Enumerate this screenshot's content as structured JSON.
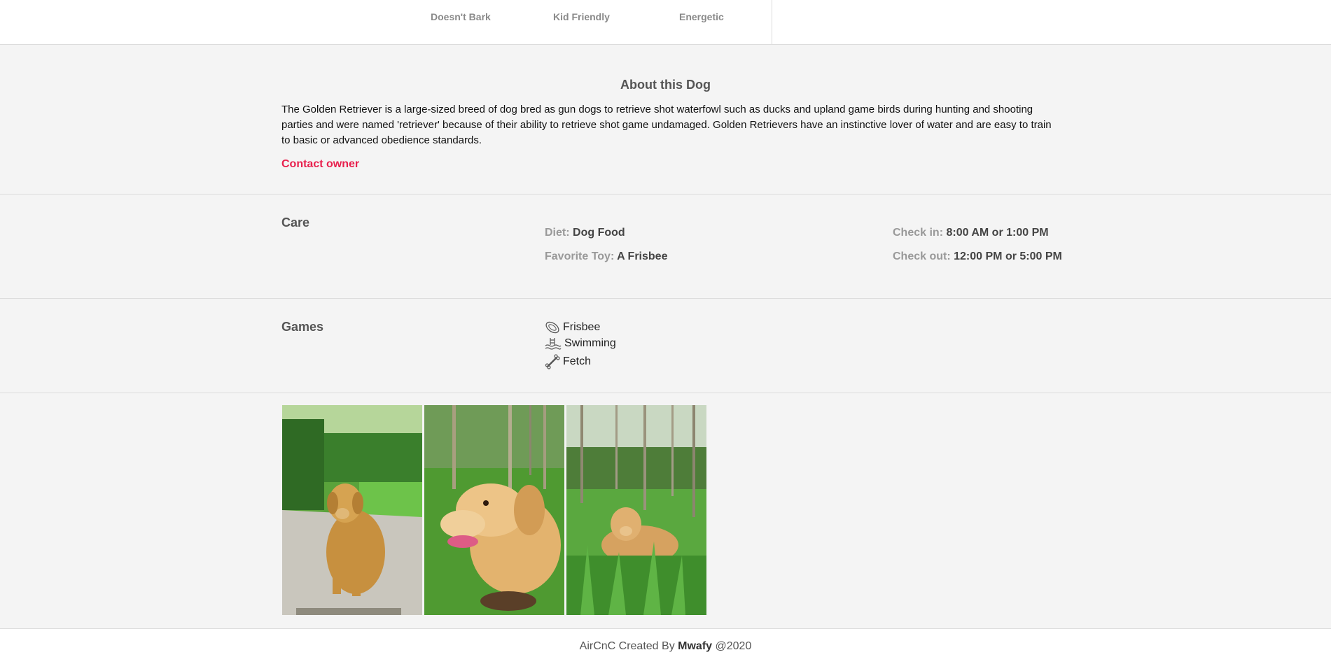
{
  "traits": [
    "Doesn't Bark",
    "Kid Friendly",
    "Energetic"
  ],
  "about": {
    "title": "About this Dog",
    "description": "The Golden Retriever is a large-sized breed of dog bred as gun dogs to retrieve shot waterfowl such as ducks and upland game birds during hunting and shooting parties and were named 'retriever' because of their ability to retrieve shot game undamaged. Golden Retrievers have an instinctive lover of water and are easy to train to basic or advanced obedience standards.",
    "contact_label": "Contact owner"
  },
  "care": {
    "heading": "Care",
    "diet_label": "Diet:",
    "diet_value": "Dog Food",
    "toy_label": "Favorite Toy:",
    "toy_value": "A Frisbee",
    "checkin_label": "Check in:",
    "checkin_value": "8:00 AM or 1:00 PM",
    "checkout_label": "Check out:",
    "checkout_value": "12:00 PM or 5:00 PM"
  },
  "games": {
    "heading": "Games",
    "items": [
      {
        "label": "Frisbee",
        "icon": "frisbee-icon"
      },
      {
        "label": "Swimming",
        "icon": "swimming-icon"
      },
      {
        "label": "Fetch",
        "icon": "bone-icon"
      }
    ]
  },
  "photos": [
    "dog-photo-sitting",
    "dog-photo-closeup",
    "dog-photo-lying-grass"
  ],
  "footer": {
    "prefix": "AirCnC Created By",
    "author": "Mwafy",
    "suffix": "@2020"
  },
  "colors": {
    "accent": "#e8204d",
    "background": "#f4f4f4",
    "border": "#dcdcdc"
  }
}
